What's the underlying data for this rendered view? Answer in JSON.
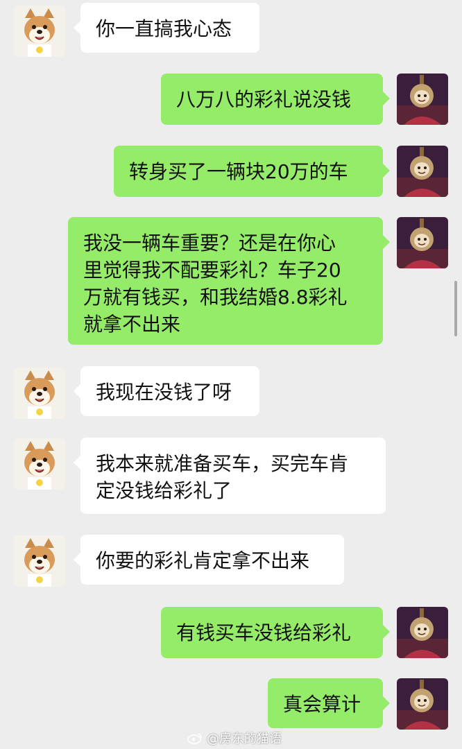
{
  "chat": {
    "messages": [
      {
        "side": "left",
        "text": "你一直搞我心态"
      },
      {
        "side": "right",
        "text": "八万八的彩礼说没钱"
      },
      {
        "side": "right",
        "text": "转身买了一辆块20万的车"
      },
      {
        "side": "right",
        "text": "我没一辆车重要？还是在你心\n里觉得我不配要彩礼？车子20\n万就有钱买，和我结婚8.8彩礼\n就拿不出来"
      },
      {
        "side": "left",
        "text": "我现在没钱了呀"
      },
      {
        "side": "left",
        "text": "我本来就准备买车，买完车肯\n定没钱给彩礼了"
      },
      {
        "side": "left",
        "text": "你要的彩礼肯定拿不出来"
      },
      {
        "side": "right",
        "text": "有钱买车没钱给彩礼"
      },
      {
        "side": "right",
        "text": "真会算计"
      }
    ]
  },
  "watermark": {
    "text": "@房东的猫语"
  },
  "colors": {
    "background": "#ededed",
    "sent_bubble": "#95ec69",
    "received_bubble": "#ffffff"
  },
  "avatars": {
    "left_icon": "shiba-dog-avatar",
    "right_icon": "teletubby-avatar"
  }
}
